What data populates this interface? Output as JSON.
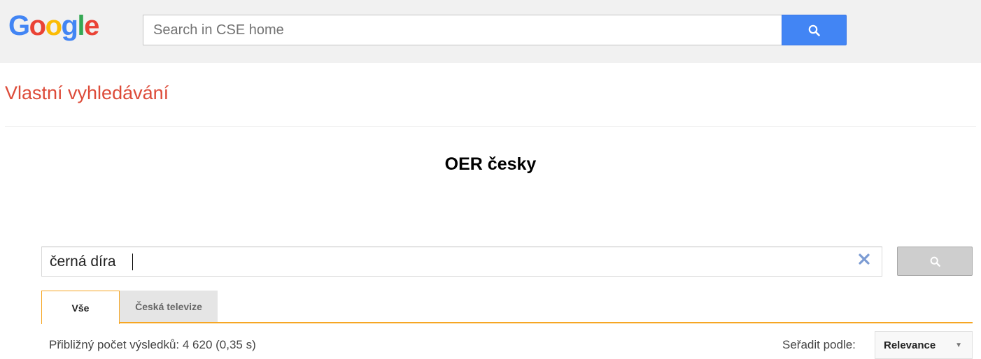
{
  "header": {
    "logo_letters": [
      "G",
      "o",
      "o",
      "g",
      "l",
      "e"
    ],
    "search_placeholder": "Search in CSE home",
    "search_button_icon": "search-icon"
  },
  "page": {
    "title": "Vlastní vyhledávání",
    "engine_name": "OER česky"
  },
  "cse": {
    "query": "černá díra",
    "clear_icon": "close-icon",
    "search_button_icon": "search-icon"
  },
  "tabs": [
    {
      "label": "Vše",
      "active": true
    },
    {
      "label": "Česká televize",
      "active": false
    }
  ],
  "results": {
    "info": "Přibližný počet výsledků: 4 620 (0,35 s)",
    "sort_label": "Seřadit podle:",
    "sort_value": "Relevance"
  },
  "colors": {
    "google_blue": "#4285f4",
    "google_red": "#ea4335",
    "google_yellow": "#fbbc05",
    "google_green": "#34a853",
    "title_red": "#dd4b39",
    "tab_orange": "#f6a623",
    "clear_blue": "#7b9bd3"
  }
}
